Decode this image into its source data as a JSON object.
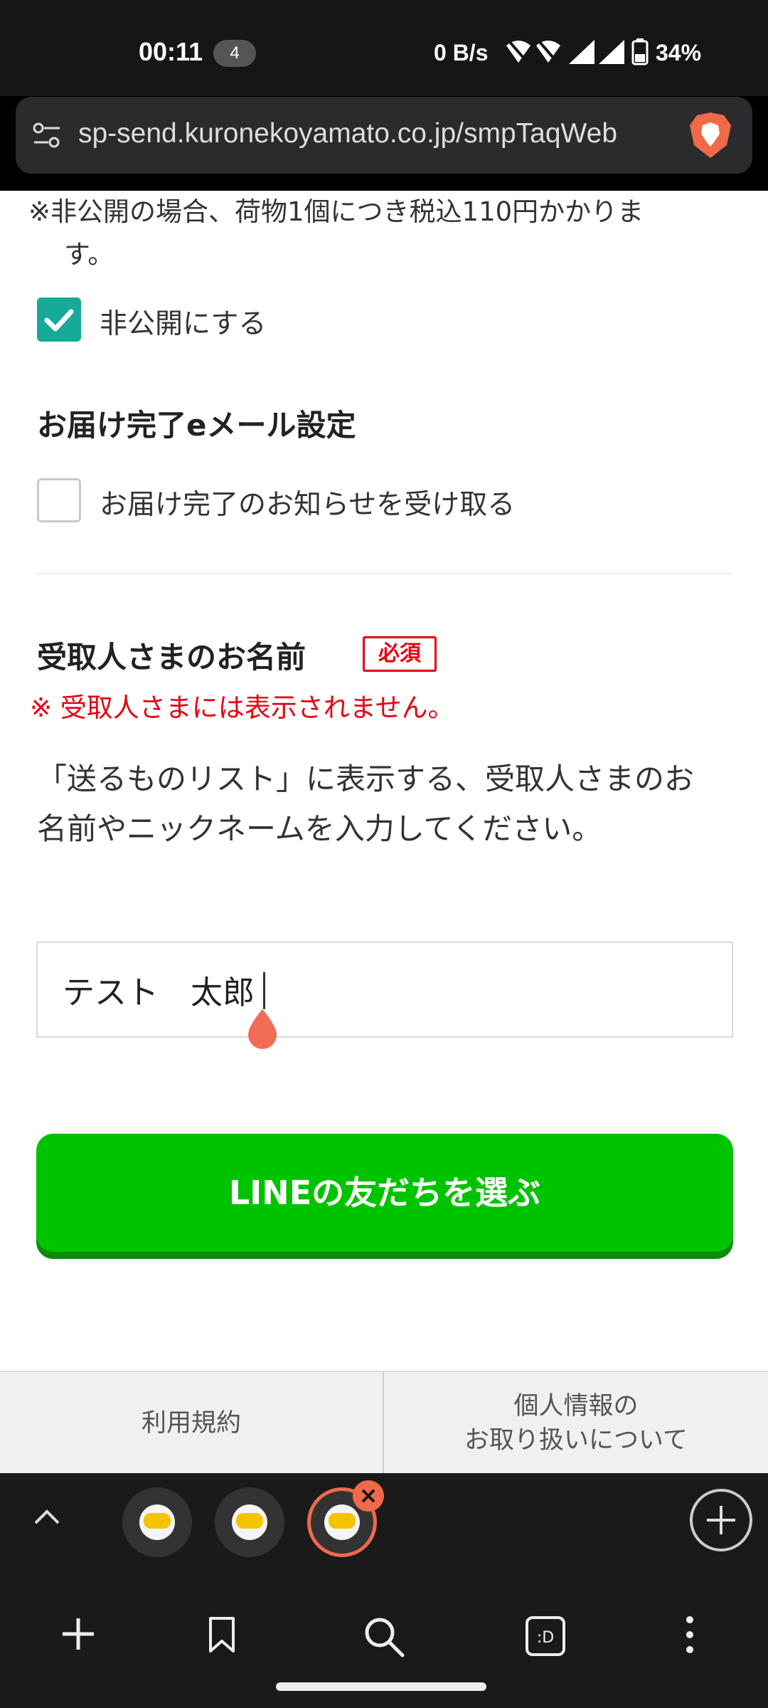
{
  "status_bar": {
    "time": "00:11",
    "notification_count": "4",
    "net_speed": "0 B/s",
    "battery": "34%",
    "wifi_label": "6",
    "sim1": "1",
    "sim2": "2"
  },
  "url_bar": {
    "url": "sp-send.kuronekoyamato.co.jp/smpTaqWeb"
  },
  "page": {
    "note_line1": "※非公開の場合、荷物1個につき税込110円かかりま",
    "note_line2": "す。",
    "private_checkbox_label": "非公開にする",
    "private_checked": true,
    "email_section_title": "お届け完了eメール設定",
    "email_checkbox_label": "お届け完了のお知らせを受け取る",
    "email_checked": false,
    "recipient_title": "受取人さまのお名前",
    "required_badge": "必須",
    "recipient_note": "※ 受取人さまには表示されません。",
    "recipient_desc": "「送るものリスト」に表示する、受取人さまのお名前やニックネームを入力してください。",
    "recipient_name_value": "テスト　太郎",
    "line_button": "LINEの友だちを選ぶ",
    "footer_terms": "利用規約",
    "footer_privacy_line1": "個人情報の",
    "footer_privacy_line2": "お取り扱いについて"
  },
  "colors": {
    "accent_teal": "#17a99a",
    "required_red": "#e60012",
    "line_green": "#00c300",
    "brave_orange": "#f06a4a"
  }
}
